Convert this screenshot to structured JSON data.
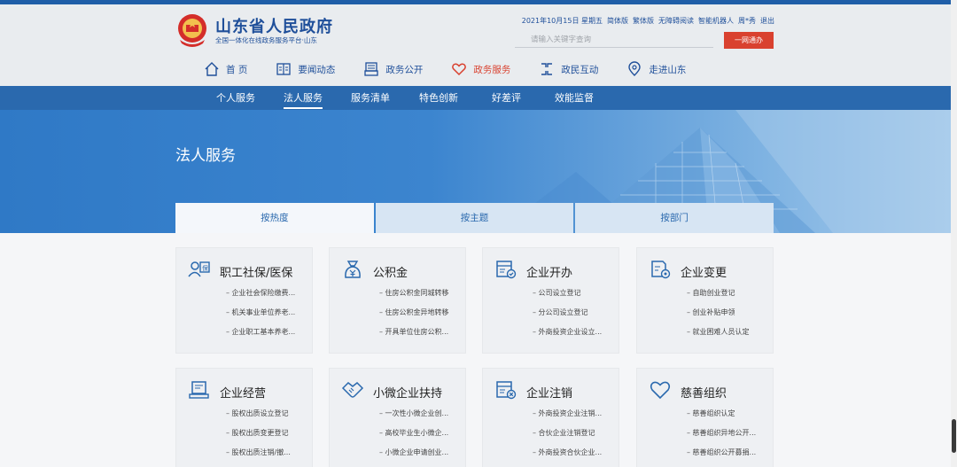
{
  "header": {
    "site_title": "山东省人民政府",
    "site_sub": "全国一体化在线政务服务平台·山东",
    "toplinks": [
      "2021年10月15日 星期五",
      "简体版",
      "繁体版",
      "无障碍阅读",
      "智能机器人",
      "周*秀",
      "退出"
    ],
    "search_placeholder": "请输入关键字查询",
    "search_button": "一网通办"
  },
  "mainnav": [
    {
      "label": "首 页",
      "icon": "home-icon"
    },
    {
      "label": "要闻动态",
      "icon": "news-icon"
    },
    {
      "label": "政务公开",
      "icon": "open-gov-icon"
    },
    {
      "label": "政务服务",
      "icon": "heart-icon"
    },
    {
      "label": "政民互动",
      "icon": "interaction-icon"
    },
    {
      "label": "走进山东",
      "icon": "location-icon"
    }
  ],
  "subnav": [
    "个人服务",
    "法人服务",
    "服务清单",
    "特色创新",
    "好差评",
    "效能监督"
  ],
  "banner": {
    "title": "法人服务"
  },
  "tabs": [
    "按热度",
    "按主题",
    "按部门"
  ],
  "cards": [
    {
      "title": "职工社保/医保",
      "icon": "social-insurance-icon",
      "items": [
        "企业社会保险缴费...",
        "机关事业单位养老...",
        "企业职工基本养老..."
      ]
    },
    {
      "title": "公积金",
      "icon": "fund-icon",
      "items": [
        "住房公积金同城转移",
        "住房公积金异地转移",
        "开具单位住房公积..."
      ]
    },
    {
      "title": "企业开办",
      "icon": "company-open-icon",
      "items": [
        "公司设立登记",
        "分公司设立登记",
        "外商投资企业设立..."
      ]
    },
    {
      "title": "企业变更",
      "icon": "company-change-icon",
      "items": [
        "自助创业登记",
        "创业补贴申领",
        "就业困难人员认定"
      ]
    },
    {
      "title": "企业经营",
      "icon": "business-icon",
      "items": [
        "股权出质设立登记",
        "股权出质变更登记",
        "股权出质注销/撤..."
      ]
    },
    {
      "title": "小微企业扶持",
      "icon": "handshake-icon",
      "items": [
        "一次性小微企业创...",
        "高校毕业生小微企...",
        "小微企业申请创业..."
      ]
    },
    {
      "title": "企业注销",
      "icon": "company-cancel-icon",
      "items": [
        "外商投资企业注销...",
        "合伙企业注销登记",
        "外商投资合伙企业..."
      ]
    },
    {
      "title": "慈善组织",
      "icon": "charity-heart-icon",
      "items": [
        "慈善组织认定",
        "慈善组织异地公开...",
        "慈善组织公开募捐..."
      ]
    }
  ],
  "colors": {
    "primary": "#1f5ea8",
    "accent": "#d9412f",
    "subnav": "#2a69ae"
  }
}
